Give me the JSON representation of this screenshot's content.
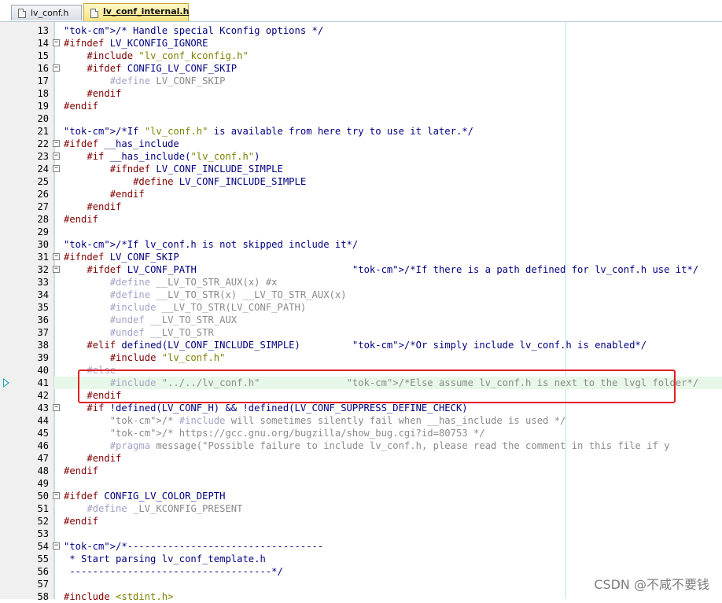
{
  "tabs": [
    {
      "label": "lv_conf.h",
      "active": false
    },
    {
      "label": "lv_conf_internal.h",
      "active": true
    }
  ],
  "watermark": "CSDN @不咸不要钱",
  "colors": {
    "comment": "#008000",
    "preprocessor": "#800000",
    "string": "#808000",
    "highlight": "#e02020"
  },
  "current_line": 41,
  "lines": [
    {
      "n": "13",
      "fold": "",
      "text": "/* Handle special Kconfig options */"
    },
    {
      "n": "14",
      "fold": "-",
      "text": "#ifndef LV_KCONFIG_IGNORE"
    },
    {
      "n": "15",
      "fold": "",
      "text": "    #include \"lv_conf_kconfig.h\""
    },
    {
      "n": "16",
      "fold": "-",
      "text": "    #ifdef CONFIG_LV_CONF_SKIP"
    },
    {
      "n": "17",
      "fold": "",
      "text": "        #define LV_CONF_SKIP"
    },
    {
      "n": "18",
      "fold": "",
      "text": "    #endif"
    },
    {
      "n": "19",
      "fold": "",
      "text": "#endif"
    },
    {
      "n": "20",
      "fold": "",
      "text": ""
    },
    {
      "n": "21",
      "fold": "",
      "text": "/*If \"lv_conf.h\" is available from here try to use it later.*/"
    },
    {
      "n": "22",
      "fold": "-",
      "text": "#ifdef __has_include"
    },
    {
      "n": "23",
      "fold": "-",
      "text": "    #if __has_include(\"lv_conf.h\")"
    },
    {
      "n": "24",
      "fold": "-",
      "text": "        #ifndef LV_CONF_INCLUDE_SIMPLE"
    },
    {
      "n": "25",
      "fold": "",
      "text": "            #define LV_CONF_INCLUDE_SIMPLE"
    },
    {
      "n": "26",
      "fold": "",
      "text": "        #endif"
    },
    {
      "n": "27",
      "fold": "",
      "text": "    #endif"
    },
    {
      "n": "28",
      "fold": "",
      "text": "#endif"
    },
    {
      "n": "29",
      "fold": "",
      "text": ""
    },
    {
      "n": "30",
      "fold": "",
      "text": "/*If lv_conf.h is not skipped include it*/"
    },
    {
      "n": "31",
      "fold": "-",
      "text": "#ifndef LV_CONF_SKIP"
    },
    {
      "n": "32",
      "fold": "-",
      "text": "    #ifdef LV_CONF_PATH                           /*If there is a path defined for lv_conf.h use it*/"
    },
    {
      "n": "33",
      "fold": "",
      "text": "        #define __LV_TO_STR_AUX(x) #x"
    },
    {
      "n": "34",
      "fold": "",
      "text": "        #define __LV_TO_STR(x) __LV_TO_STR_AUX(x)"
    },
    {
      "n": "35",
      "fold": "",
      "text": "        #include __LV_TO_STR(LV_CONF_PATH)"
    },
    {
      "n": "36",
      "fold": "",
      "text": "        #undef __LV_TO_STR_AUX"
    },
    {
      "n": "37",
      "fold": "",
      "text": "        #undef __LV_TO_STR"
    },
    {
      "n": "38",
      "fold": "",
      "text": "    #elif defined(LV_CONF_INCLUDE_SIMPLE)         /*Or simply include lv_conf.h is enabled*/"
    },
    {
      "n": "39",
      "fold": "",
      "text": "        #include \"lv_conf.h\""
    },
    {
      "n": "40",
      "fold": "",
      "text": "    #else"
    },
    {
      "n": "41",
      "fold": "",
      "text": "        #include \"../../lv_conf.h\"               /*Else assume lv_conf.h is next to the lvgl folder*/"
    },
    {
      "n": "42",
      "fold": "",
      "text": "    #endif"
    },
    {
      "n": "43",
      "fold": "-",
      "text": "    #if !defined(LV_CONF_H) && !defined(LV_CONF_SUPPRESS_DEFINE_CHECK)"
    },
    {
      "n": "44",
      "fold": "",
      "text": "        /* #include will sometimes silently fail when __has_include is used */"
    },
    {
      "n": "45",
      "fold": "",
      "text": "        /* https://gcc.gnu.org/bugzilla/show_bug.cgi?id=80753 */"
    },
    {
      "n": "46",
      "fold": "",
      "text": "        #pragma message(\"Possible failure to include lv_conf.h, please read the comment in this file if y"
    },
    {
      "n": "47",
      "fold": "",
      "text": "    #endif"
    },
    {
      "n": "48",
      "fold": "",
      "text": "#endif"
    },
    {
      "n": "49",
      "fold": "",
      "text": ""
    },
    {
      "n": "50",
      "fold": "-",
      "text": "#ifdef CONFIG_LV_COLOR_DEPTH"
    },
    {
      "n": "51",
      "fold": "",
      "text": "    #define _LV_KCONFIG_PRESENT"
    },
    {
      "n": "52",
      "fold": "",
      "text": "#endif"
    },
    {
      "n": "53",
      "fold": "",
      "text": ""
    },
    {
      "n": "54",
      "fold": "-",
      "text": "/*----------------------------------"
    },
    {
      "n": "55",
      "fold": "",
      "text": " * Start parsing lv_conf_template.h"
    },
    {
      "n": "56",
      "fold": "",
      "text": " -----------------------------------*/"
    },
    {
      "n": "57",
      "fold": "",
      "text": ""
    },
    {
      "n": "58",
      "fold": "",
      "text": "#include <stdint.h>"
    }
  ]
}
